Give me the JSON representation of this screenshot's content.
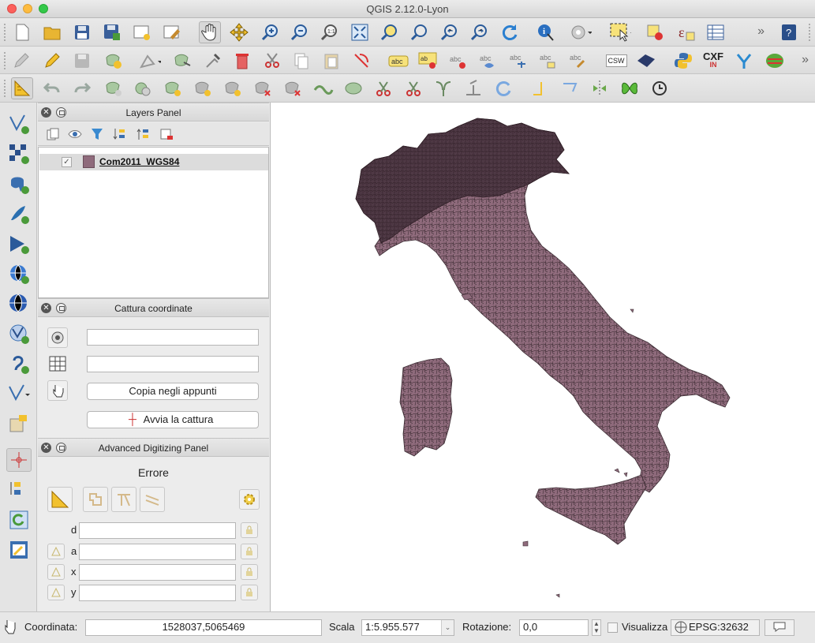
{
  "window": {
    "title": "QGIS 2.12.0-Lyon"
  },
  "colors": {
    "layer_fill": "#8f6b7c",
    "layer_stroke": "#3a2a31",
    "map_background": "#ffffff"
  },
  "toolbar1": {
    "icons": [
      "new-project-icon",
      "open-project-icon",
      "save-project-icon",
      "save-as-icon",
      "new-print-composer-icon",
      "composer-manager-icon",
      "pan-hand-icon",
      "pan-to-selection-icon",
      "zoom-in-icon",
      "zoom-out-icon",
      "zoom-actual-icon",
      "zoom-full-icon",
      "zoom-to-selection-icon",
      "zoom-to-layer-icon",
      "zoom-last-icon",
      "zoom-next-icon",
      "refresh-icon",
      "identify-icon",
      "run-action-icon",
      "select-features-icon",
      "deselect-icon",
      "expression-select-icon",
      "attribute-table-icon",
      "overflow-chevron-icon",
      "help-icon"
    ],
    "overflow": "»"
  },
  "toolbar2": {
    "icons": [
      "current-edits-icon",
      "toggle-editing-icon",
      "save-edits-icon",
      "add-feature-icon",
      "move-feature-icon",
      "node-tool-icon",
      "delete-selected-icon",
      "cut-features-icon",
      "copy-features-icon",
      "paste-features-icon",
      "label-pin-icon",
      "abc-label-icon",
      "abc-pin-icon",
      "abc-highlight-icon",
      "abc-show-icon",
      "abc-move-icon",
      "abc-rotate-icon",
      "abc-change-icon",
      "csw-icon",
      "metasearch-icon",
      "python-icon",
      "cxf-in-icon",
      "vertex-tool-icon",
      "georef-icon"
    ],
    "csw": "CSW",
    "cxf": "CXF",
    "cxf_in": "IN",
    "overflow": "»"
  },
  "toolbar3": {
    "icons": [
      "digitize-angle-icon",
      "undo-icon",
      "redo-icon",
      "ring-icon",
      "part-icon",
      "fill-ring-icon",
      "delete-ring-icon",
      "delete-part-icon",
      "reshape-icon",
      "offset-icon",
      "simplify-icon",
      "split-feature-icon",
      "split-parts-icon",
      "merge-features-icon",
      "merge-attributes-icon",
      "rotate-symbols-icon",
      "rotate-point-icon",
      "snap-corner-icon",
      "snap-line-icon",
      "mirror-icon",
      "butterfly-icon",
      "rotate-feature-icon"
    ]
  },
  "layers_panel": {
    "title": "Layers Panel",
    "layers": [
      {
        "name": "Com2011_WGS84",
        "visible_check": "✓"
      }
    ]
  },
  "coord_panel": {
    "title": "Cattura coordinate",
    "field1": "",
    "field2": "",
    "copy_button": "Copia negli appunti",
    "start_button": "Avvia la cattura"
  },
  "adv_panel": {
    "title": "Advanced Digitizing Panel",
    "error_text": "Errore",
    "rows": [
      {
        "label": "d",
        "value": ""
      },
      {
        "label": "a",
        "value": ""
      },
      {
        "label": "x",
        "value": ""
      },
      {
        "label": "y",
        "value": ""
      }
    ]
  },
  "status": {
    "coord_label": "Coordinata:",
    "coord_value": "1528037,5065469",
    "scale_label": "Scala",
    "scale_value": "1:5.955.577",
    "rotation_label": "Rotazione:",
    "rotation_value": "0,0",
    "render_label": "Visualizza",
    "crs": "EPSG:32632"
  }
}
